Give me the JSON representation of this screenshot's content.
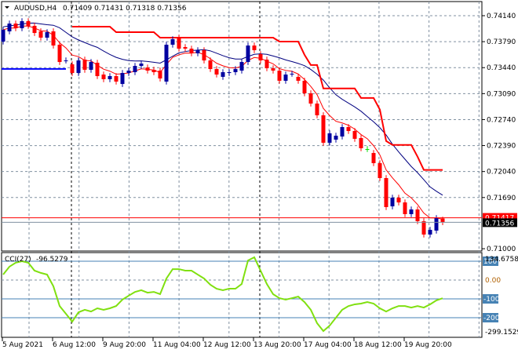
{
  "chart_data": {
    "type": "candlestick",
    "symbol_header": "AUDUSD,H4",
    "ohlc_header": "0.71409 0.71431 0.71318 0.71356",
    "last": {
      "open": 0.71409,
      "high": 0.71431,
      "low": 0.71318,
      "close": 0.71356
    },
    "ylim": [
      0.71,
      0.7414
    ],
    "y_ticks": [
      "0.74140",
      "0.73790",
      "0.73440",
      "0.73090",
      "0.72740",
      "0.72390",
      "0.72040",
      "0.71690",
      "0.71000"
    ],
    "ask_label": "0.71417",
    "bid_label": "0.71356",
    "x_ticks": [
      "5 Aug 2021",
      "6 Aug 12:00",
      "9 Aug 20:00",
      "11 Aug 04:00",
      "12 Aug 12:00",
      "13 Aug 20:00",
      "17 Aug 04:00",
      "18 Aug 12:00",
      "19 Aug 20:00"
    ],
    "x_tick_candle_index": [
      0,
      8,
      16,
      24,
      32,
      40,
      48,
      56,
      64
    ],
    "candles_oc": [
      [
        0.73791,
        0.7395
      ],
      [
        0.73929,
        0.74034
      ],
      [
        0.74034,
        0.73971
      ],
      [
        0.73971,
        0.74066
      ],
      [
        0.74066,
        0.74003
      ],
      [
        0.74003,
        0.73907
      ],
      [
        0.73929,
        0.73844
      ],
      [
        0.73844,
        0.73918
      ],
      [
        0.73929,
        0.73738
      ],
      [
        0.73749,
        0.73516
      ],
      [
        0.73537,
        0.73537
      ],
      [
        0.73485,
        0.73368
      ],
      [
        0.73368,
        0.73537
      ],
      [
        0.73548,
        0.73411
      ],
      [
        0.73411,
        0.73516
      ],
      [
        0.73506,
        0.73326
      ],
      [
        0.73347,
        0.73284
      ],
      [
        0.73284,
        0.73326
      ],
      [
        0.73326,
        0.73252
      ],
      [
        0.7322,
        0.73368
      ],
      [
        0.73368,
        0.734
      ],
      [
        0.73379,
        0.73463
      ],
      [
        0.73463,
        0.73495
      ],
      [
        0.73442,
        0.734
      ],
      [
        0.73411,
        0.73379
      ],
      [
        0.734,
        0.73294
      ],
      [
        0.73252,
        0.73749
      ],
      [
        0.73749,
        0.73823
      ],
      [
        0.73844,
        0.73696
      ],
      [
        0.73717,
        0.73696
      ],
      [
        0.73696,
        0.73633
      ],
      [
        0.73633,
        0.73675
      ],
      [
        0.73675,
        0.73537
      ],
      [
        0.73537,
        0.73421
      ],
      [
        0.73421,
        0.73347
      ],
      [
        0.73316,
        0.73379
      ],
      [
        0.73368,
        0.73379
      ],
      [
        0.73379,
        0.73421
      ],
      [
        0.734,
        0.73516
      ],
      [
        0.73516,
        0.73738
      ],
      [
        0.73738,
        0.73675
      ],
      [
        0.73622,
        0.73537
      ],
      [
        0.73548,
        0.73432
      ],
      [
        0.73432,
        0.734
      ],
      [
        0.734,
        0.73263
      ],
      [
        0.73263,
        0.73347
      ],
      [
        0.73358,
        0.73358
      ],
      [
        0.73316,
        0.73263
      ],
      [
        0.73263,
        0.73094
      ],
      [
        0.73094,
        0.72956
      ],
      [
        0.72956,
        0.72798
      ],
      [
        0.72798,
        0.72428
      ],
      [
        0.72428,
        0.72555
      ],
      [
        0.7247,
        0.72523
      ],
      [
        0.72512,
        0.72639
      ],
      [
        0.72639,
        0.72586
      ],
      [
        0.72586,
        0.72481
      ],
      [
        0.72491,
        0.72354
      ],
      [
        0.72343,
        0.72343
      ],
      [
        0.7229,
        0.72153
      ],
      [
        0.72153,
        0.71952
      ],
      [
        0.71952,
        0.71561
      ],
      [
        0.71571,
        0.71688
      ],
      [
        0.71688,
        0.71624
      ],
      [
        0.71624,
        0.71466
      ],
      [
        0.71466,
        0.71529
      ],
      [
        0.71529,
        0.71371
      ],
      [
        0.71371,
        0.71191
      ],
      [
        0.71191,
        0.71254
      ],
      [
        0.71244,
        0.71413
      ],
      [
        0.71409,
        0.71356
      ]
    ],
    "step_line_start_index": 11,
    "step_line": [
      0.73992,
      0.73992,
      0.73992,
      0.73992,
      0.73992,
      0.73992,
      0.73992,
      0.73918,
      0.73918,
      0.73918,
      0.73918,
      0.73918,
      0.73918,
      0.73918,
      0.73844,
      0.73844,
      0.73844,
      0.73844,
      0.73844,
      0.73844,
      0.73844,
      0.73844,
      0.73844,
      0.73844,
      0.73844,
      0.73844,
      0.73844,
      0.73844,
      0.73844,
      0.73844,
      0.73844,
      0.73844,
      0.73844,
      0.73791,
      0.73791,
      0.73791,
      0.73791,
      0.73613,
      0.73475,
      0.73475,
      0.73159,
      0.73159,
      0.73159,
      0.73159,
      0.73159,
      0.73159,
      0.73032,
      0.73032,
      0.73032,
      0.72874,
      0.72452,
      0.72399,
      0.72399,
      0.72399,
      0.72399,
      0.72241,
      0.72062,
      0.72062,
      0.72062,
      0.72062
    ],
    "level_line": {
      "value": 0.73422,
      "from_index": 0,
      "to_index": 10
    },
    "colors": {
      "bull": "#0000a0",
      "bear": "#ff0000",
      "doji": "#00dd00",
      "ma_slow": "#000080",
      "ma_fast": "#ff0000",
      "step": "#ff0000",
      "level": "#0000ff",
      "cci": "#80e010",
      "level_box": "#4682b4"
    },
    "cci": {
      "label": "CCI(27)",
      "value_label": "-96.5279",
      "max_label": "134.6758",
      "min_label": "-299.1529",
      "ylim": [
        -299.1529,
        134.6758
      ],
      "levels": [
        "100",
        "0.00",
        "-100",
        "-200"
      ],
      "values": [
        29,
        71,
        92,
        100,
        92,
        50,
        38,
        29,
        -33,
        -138,
        -179,
        -221,
        -171,
        -158,
        -167,
        -150,
        -158,
        -150,
        -138,
        -104,
        -83,
        -63,
        -54,
        -67,
        -63,
        -75,
        8,
        58,
        58,
        50,
        50,
        29,
        8,
        -25,
        -46,
        -54,
        -46,
        -46,
        -21,
        104,
        121,
        50,
        -21,
        -75,
        -96,
        -104,
        -96,
        -88,
        -117,
        -158,
        -229,
        -271,
        -242,
        -200,
        -158,
        -138,
        -129,
        -125,
        -117,
        -125,
        -150,
        -167,
        -150,
        -138,
        -138,
        -146,
        -138,
        -146,
        -129,
        -108,
        -96.5279
      ]
    }
  }
}
